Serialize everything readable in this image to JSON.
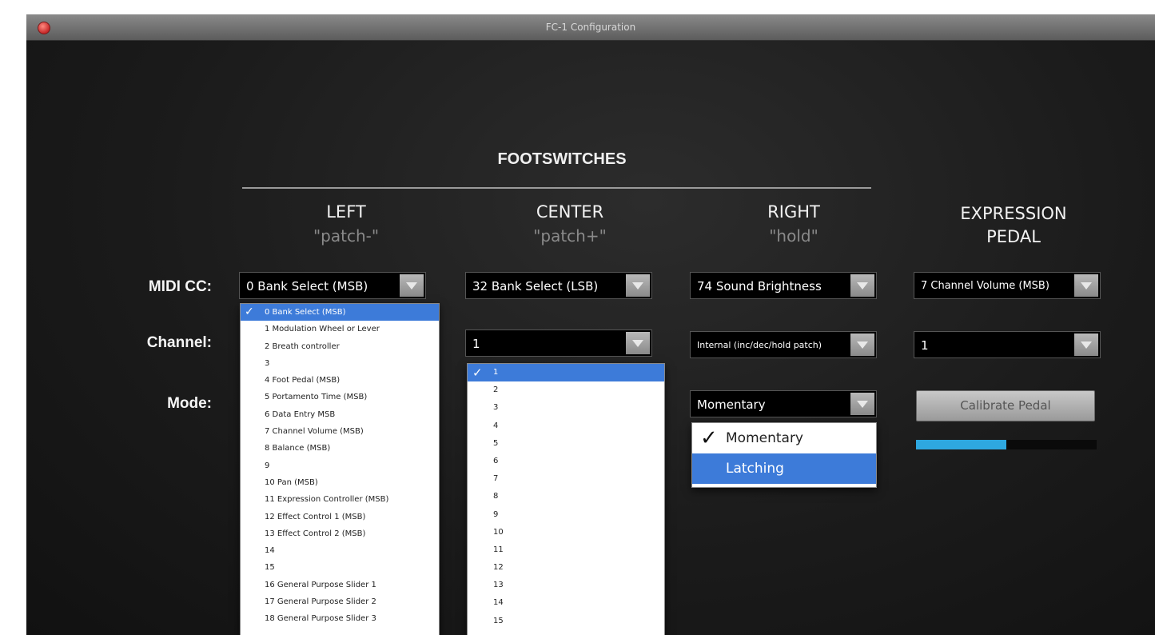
{
  "window": {
    "title": "FC-1 Configuration"
  },
  "section_title": "FOOTSWITCHES",
  "columns": [
    {
      "name": "LEFT",
      "sub": "\"patch-\""
    },
    {
      "name": "CENTER",
      "sub": "\"patch+\""
    },
    {
      "name": "RIGHT",
      "sub": "\"hold\""
    },
    {
      "name": "EXPRESSION",
      "name2": "PEDAL"
    }
  ],
  "row_labels": {
    "midi_cc": "MIDI CC:",
    "channel": "Channel:",
    "mode": "Mode:"
  },
  "selects": {
    "left_cc": "0 Bank Select (MSB)",
    "center_cc": "32 Bank Select (LSB)",
    "right_cc": "74 Sound Brightness",
    "expr_cc": "7 Channel Volume (MSB)",
    "center_channel": "1",
    "right_channel": "Internal (inc/dec/hold patch)",
    "expr_channel": "1",
    "right_mode": "Momentary"
  },
  "left_cc_options": [
    "0 Bank Select (MSB)",
    "1 Modulation Wheel or Lever",
    "2 Breath controller",
    "3",
    "4 Foot Pedal (MSB)",
    "5 Portamento Time (MSB)",
    "6 Data Entry MSB",
    "7 Channel Volume (MSB)",
    "8 Balance (MSB)",
    "9",
    "10 Pan (MSB)",
    "11 Expression Controller (MSB)",
    "12 Effect Control 1 (MSB)",
    "13 Effect Control 2 (MSB)",
    "14",
    "15",
    "16 General Purpose Slider 1",
    "17 General Purpose Slider 2",
    "18 General Purpose Slider 3"
  ],
  "center_channel_options": [
    "1",
    "2",
    "3",
    "4",
    "5",
    "6",
    "7",
    "8",
    "9",
    "10",
    "11",
    "12",
    "13",
    "14",
    "15"
  ],
  "right_mode_options": [
    "Momentary",
    "Latching"
  ],
  "checkmark": "✓",
  "calibrate_label": "Calibrate Pedal",
  "pedal_level": 0.5
}
